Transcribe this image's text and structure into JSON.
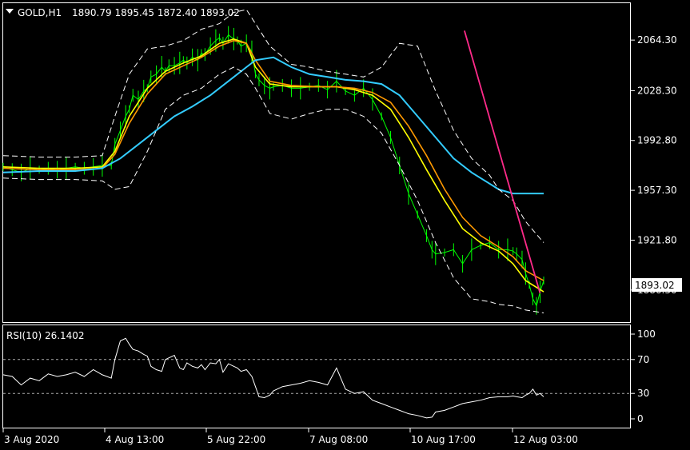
{
  "chart_data": {
    "type": "line",
    "symbol_header": "GOLD,H1",
    "ohlc_text": "1890.79 1895.45 1872.40 1893.02",
    "current_price": "1893.02",
    "price_axis": {
      "ticks": [
        "2064.30",
        "2028.30",
        "1992.80",
        "1957.30",
        "1921.80",
        "1886.30"
      ],
      "ylim": [
        1864,
        2090
      ]
    },
    "time_axis": {
      "ticks": [
        "3 Aug 2020",
        "4 Aug 13:00",
        "5 Aug 22:00",
        "7 Aug 08:00",
        "10 Aug 17:00",
        "12 Aug 03:00"
      ]
    },
    "series": [
      {
        "name": "price",
        "color": "#00ff00",
        "x": [
          0,
          5,
          10,
          15,
          20,
          25,
          30,
          35,
          40,
          45,
          50,
          55,
          60,
          62,
          65,
          68,
          70,
          72,
          75,
          78,
          80,
          82,
          85,
          88,
          90,
          92,
          95,
          98,
          100,
          102,
          105,
          108,
          110,
          112,
          115,
          118,
          120,
          122,
          125,
          128,
          130,
          132,
          135,
          138,
          140,
          142,
          145,
          148,
          150,
          155,
          160,
          165,
          170,
          175,
          180,
          185,
          190,
          195,
          200,
          205,
          210,
          215,
          220,
          225,
          230,
          235,
          238,
          240,
          245,
          250,
          255,
          260,
          265,
          270,
          275,
          280,
          283,
          285,
          288,
          290,
          292,
          294,
          296,
          298,
          300
        ],
        "y": [
          1974,
          1972,
          1970,
          1973,
          1972,
          1973,
          1972,
          1973,
          1974,
          1973,
          1974,
          1975,
          1975,
          1990,
          2000,
          2010,
          2015,
          2025,
          2022,
          2028,
          2030,
          2038,
          2040,
          2045,
          2042,
          2046,
          2046,
          2048,
          2050,
          2048,
          2052,
          2050,
          2055,
          2054,
          2060,
          2064,
          2066,
          2062,
          2068,
          2065,
          2064,
          2060,
          2062,
          2056,
          2040,
          2036,
          2032,
          2030,
          2031,
          2032,
          2030,
          2030,
          2031,
          2032,
          2029,
          2035,
          2028,
          2025,
          2030,
          2022,
          2010,
          1995,
          1975,
          1955,
          1940,
          1925,
          1915,
          1912,
          1913,
          1915,
          1905,
          1915,
          1918,
          1920,
          1915,
          1915,
          1914,
          1912,
          1908,
          1898,
          1890,
          1880,
          1875,
          1885,
          1893
        ]
      },
      {
        "name": "ma-yellow",
        "color": "#ffff00",
        "x": [
          0,
          20,
          40,
          55,
          62,
          70,
          80,
          90,
          100,
          110,
          120,
          128,
          135,
          140,
          148,
          160,
          175,
          185,
          195,
          205,
          215,
          225,
          235,
          245,
          255,
          265,
          275,
          283,
          290,
          300
        ],
        "y": [
          1974,
          1973,
          1973,
          1974,
          1985,
          2010,
          2030,
          2042,
          2048,
          2053,
          2062,
          2065,
          2062,
          2045,
          2033,
          2031,
          2031,
          2031,
          2029,
          2025,
          2015,
          1995,
          1972,
          1950,
          1930,
          1920,
          1914,
          1905,
          1893,
          1885
        ]
      },
      {
        "name": "ma-orange",
        "color": "#ff9900",
        "x": [
          0,
          20,
          40,
          55,
          62,
          70,
          80,
          90,
          100,
          110,
          120,
          128,
          135,
          140,
          148,
          160,
          175,
          185,
          195,
          205,
          215,
          225,
          235,
          245,
          255,
          265,
          275,
          283,
          290,
          300
        ],
        "y": [
          1973,
          1972,
          1972,
          1973,
          1983,
          2005,
          2026,
          2040,
          2046,
          2052,
          2060,
          2064,
          2062,
          2050,
          2035,
          2032,
          2031,
          2031,
          2030,
          2027,
          2020,
          2003,
          1982,
          1958,
          1938,
          1925,
          1917,
          1910,
          1900,
          1893
        ]
      },
      {
        "name": "ma-cyan",
        "color": "#33ccff",
        "x": [
          0,
          20,
          40,
          55,
          65,
          75,
          85,
          95,
          105,
          115,
          125,
          135,
          140,
          150,
          160,
          170,
          180,
          190,
          200,
          210,
          220,
          230,
          240,
          250,
          260,
          270,
          275,
          283,
          290,
          300
        ],
        "y": [
          1970,
          1971,
          1971,
          1973,
          1980,
          1990,
          2000,
          2010,
          2017,
          2025,
          2035,
          2045,
          2050,
          2052,
          2045,
          2040,
          2038,
          2036,
          2035,
          2033,
          2025,
          2010,
          1995,
          1980,
          1970,
          1962,
          1958,
          1955,
          1955,
          1955
        ]
      },
      {
        "name": "band-upper",
        "color": "#ffffff",
        "x": [
          0,
          20,
          40,
          55,
          62,
          70,
          80,
          90,
          100,
          110,
          120,
          128,
          135,
          140,
          148,
          160,
          170,
          180,
          190,
          200,
          210,
          220,
          230,
          240,
          250,
          260,
          270,
          275,
          283,
          290,
          300
        ],
        "y": [
          1982,
          1981,
          1981,
          1982,
          2010,
          2040,
          2058,
          2060,
          2064,
          2072,
          2076,
          2084,
          2086,
          2076,
          2060,
          2047,
          2045,
          2042,
          2040,
          2038,
          2045,
          2062,
          2060,
          2028,
          2000,
          1980,
          1968,
          1958,
          1950,
          1935,
          1920
        ]
      },
      {
        "name": "band-lower",
        "color": "#ffffff",
        "x": [
          0,
          20,
          40,
          55,
          62,
          70,
          80,
          90,
          100,
          110,
          120,
          128,
          135,
          140,
          148,
          160,
          170,
          180,
          190,
          200,
          210,
          220,
          230,
          240,
          250,
          260,
          270,
          275,
          283,
          290,
          300
        ],
        "y": [
          1966,
          1965,
          1965,
          1964,
          1958,
          1960,
          1985,
          2015,
          2025,
          2030,
          2040,
          2045,
          2040,
          2030,
          2012,
          2008,
          2012,
          2015,
          2015,
          2010,
          1998,
          1975,
          1950,
          1920,
          1895,
          1880,
          1878,
          1876,
          1875,
          1872,
          1870
        ]
      },
      {
        "name": "trendline",
        "color": "#ff2a8a",
        "x": [
          256,
          298
        ],
        "y": [
          2071,
          1884
        ]
      }
    ],
    "rsi": {
      "label_text": "RSI(10) 26.1402",
      "ticks": [
        "100",
        "70",
        "30",
        "0"
      ],
      "levels": [
        70,
        30
      ],
      "ylim": [
        0,
        100
      ],
      "color": "#ffffff",
      "x": [
        0,
        5,
        10,
        15,
        20,
        25,
        30,
        35,
        40,
        45,
        50,
        55,
        60,
        62,
        65,
        68,
        70,
        72,
        75,
        78,
        80,
        82,
        85,
        88,
        90,
        92,
        95,
        98,
        100,
        102,
        105,
        108,
        110,
        112,
        115,
        118,
        120,
        122,
        125,
        128,
        130,
        132,
        135,
        138,
        140,
        142,
        145,
        148,
        150,
        155,
        160,
        165,
        170,
        175,
        180,
        185,
        190,
        195,
        200,
        205,
        210,
        215,
        220,
        225,
        230,
        235,
        238,
        240,
        245,
        250,
        255,
        260,
        265,
        270,
        275,
        280,
        283,
        285,
        288,
        290,
        292,
        294,
        296,
        298,
        300
      ],
      "y": [
        52,
        50,
        40,
        48,
        45,
        53,
        50,
        52,
        55,
        50,
        58,
        52,
        48,
        70,
        92,
        95,
        88,
        82,
        80,
        76,
        74,
        62,
        58,
        56,
        70,
        72,
        75,
        60,
        58,
        66,
        62,
        60,
        64,
        58,
        66,
        65,
        70,
        55,
        65,
        62,
        60,
        56,
        58,
        50,
        38,
        26,
        25,
        28,
        33,
        38,
        40,
        42,
        45,
        43,
        40,
        60,
        35,
        30,
        32,
        22,
        18,
        14,
        10,
        6,
        4,
        1,
        2,
        8,
        10,
        14,
        18,
        20,
        22,
        25,
        26,
        26,
        27,
        26,
        25,
        28,
        30,
        35,
        28,
        30,
        26
      ]
    }
  }
}
